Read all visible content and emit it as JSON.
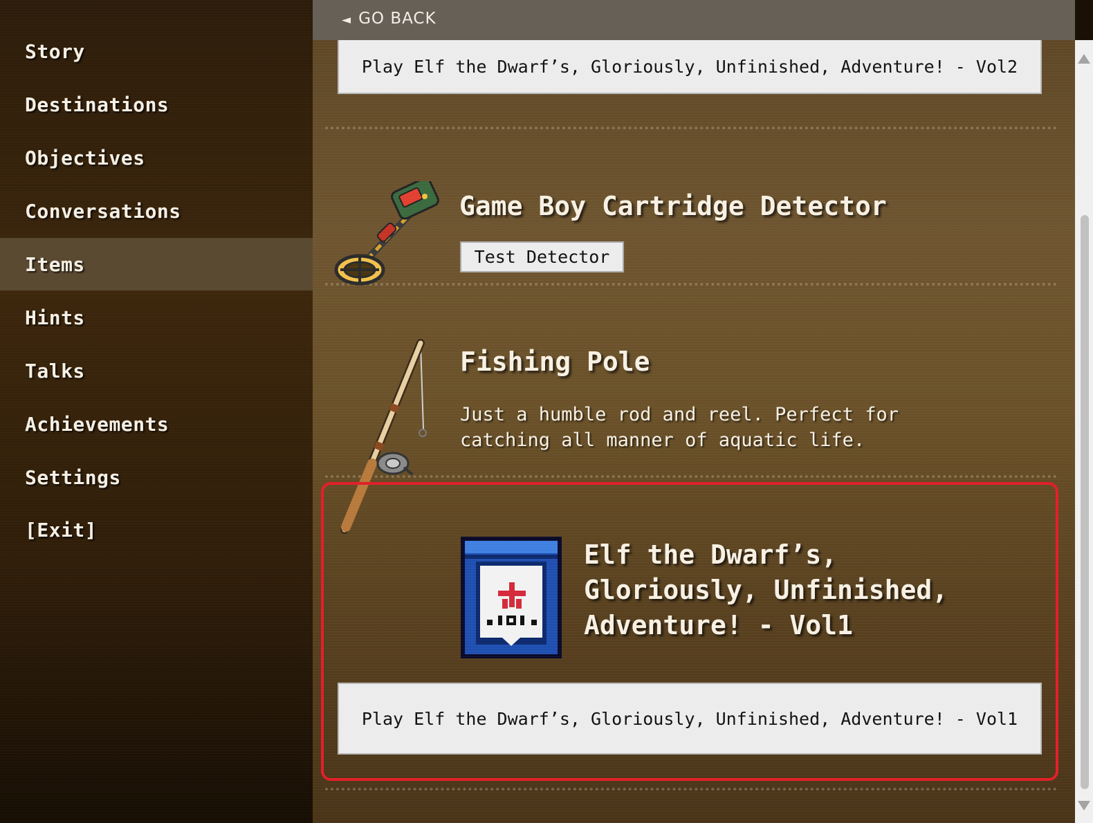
{
  "sidebar": {
    "active_item": "Items",
    "items": [
      {
        "label": "Story"
      },
      {
        "label": "Destinations"
      },
      {
        "label": "Objectives"
      },
      {
        "label": "Conversations"
      },
      {
        "label": "Items"
      },
      {
        "label": "Hints"
      },
      {
        "label": "Talks"
      },
      {
        "label": "Achievements"
      },
      {
        "label": "Settings"
      },
      {
        "label": "[Exit]"
      }
    ]
  },
  "topbar": {
    "back_arrow": "◄",
    "back_label": "GO BACK"
  },
  "items": {
    "vol2_play_label": "Play Elf the Dwarf’s, Gloriously, Unfinished, Adventure! - Vol2",
    "detector": {
      "icon": "metal-detector-icon",
      "title": "Game Boy Cartridge Detector",
      "button_label": "Test Detector"
    },
    "fishing_pole": {
      "icon": "fishing-pole-icon",
      "title": "Fishing Pole",
      "description": "Just a humble rod and reel. Perfect for catching all manner of aquatic life."
    },
    "vol1": {
      "icon": "game-cartridge-icon",
      "title": "Elf the Dwarf’s, Gloriously, Unfinished, Adventure! - Vol1",
      "play_label": "Play Elf the Dwarf’s, Gloriously, Unfinished, Adventure! - Vol1"
    }
  },
  "colors": {
    "highlight": "#e2202a",
    "active_nav": "#5b4a32",
    "text": "#f7f0e3"
  }
}
